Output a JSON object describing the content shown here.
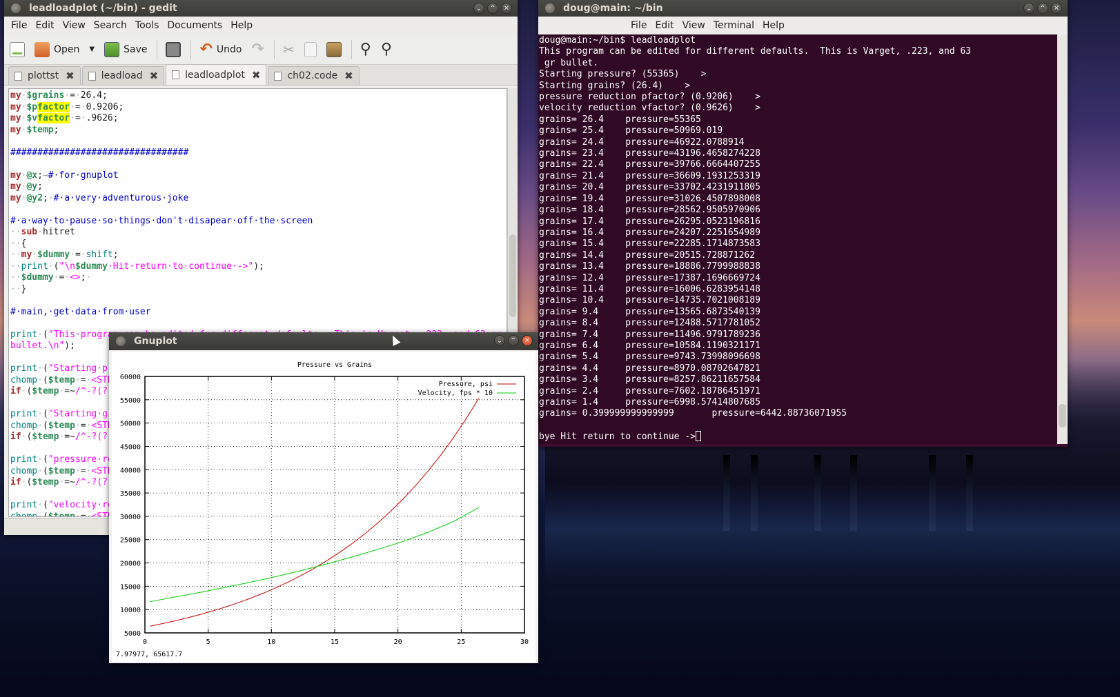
{
  "gedit": {
    "title": "leadloadplot (~/bin) - gedit",
    "menu": [
      "File",
      "Edit",
      "View",
      "Search",
      "Tools",
      "Documents",
      "Help"
    ],
    "toolbar": {
      "open_label": "Open",
      "save_label": "Save",
      "undo_label": "Undo"
    },
    "tabs": [
      {
        "label": "plottst",
        "active": false
      },
      {
        "label": "leadload",
        "active": false
      },
      {
        "label": "leadloadplot",
        "active": true
      },
      {
        "label": "ch02.code",
        "active": false
      }
    ]
  },
  "terminal": {
    "title": "doug@main: ~/bin",
    "menu": [
      "File",
      "Edit",
      "View",
      "Terminal",
      "Help"
    ],
    "lines": [
      "doug@main:~/bin$ leadloadplot",
      "This program can be edited for different defaults.  This is Varget, .223, and 63",
      " gr bullet.",
      "Starting pressure? (55365)    >",
      "Starting grains? (26.4)    >",
      "pressure reduction pfactor? (0.9206)    >",
      "velocity reduction vfactor? (0.9626)    >",
      "grains= 26.4    pressure=55365",
      "grains= 25.4    pressure=50969.019",
      "grains= 24.4    pressure=46922.0788914",
      "grains= 23.4    pressure=43196.4658274228",
      "grains= 22.4    pressure=39766.6664407255",
      "grains= 21.4    pressure=36609.1931253319",
      "grains= 20.4    pressure=33702.4231911805",
      "grains= 19.4    pressure=31026.4507898008",
      "grains= 18.4    pressure=28562.9505970906",
      "grains= 17.4    pressure=26295.0523196816",
      "grains= 16.4    pressure=24207.2251654989",
      "grains= 15.4    pressure=22285.1714873583",
      "grains= 14.4    pressure=20515.728871262",
      "grains= 13.4    pressure=18886.7799988838",
      "grains= 12.4    pressure=17387.1696669724",
      "grains= 11.4    pressure=16006.6283954148",
      "grains= 10.4    pressure=14735.7021008189",
      "grains= 9.4     pressure=13565.6873540139",
      "grains= 8.4     pressure=12488.5717781052",
      "grains= 7.4     pressure=11496.9791789236",
      "grains= 6.4     pressure=10584.1190321171",
      "grains= 5.4     pressure=9743.73998096698",
      "grains= 4.4     pressure=8970.08702647821",
      "grains= 3.4     pressure=8257.86211657584",
      "grains= 2.4     pressure=7602.18786451971",
      "grains= 1.4     pressure=6998.57414807685",
      "grains= 0.399999999999999       pressure=6442.88736071955",
      "",
      "bye Hit return to continue ->"
    ]
  },
  "gnuplot": {
    "title": "Gnuplot",
    "coords": "7.97977,  65617.7"
  },
  "chart_data": {
    "type": "line",
    "title": "Pressure vs Grains",
    "xlabel": "",
    "ylabel": "",
    "xlim": [
      0,
      30
    ],
    "ylim": [
      5000,
      60000
    ],
    "xticks": [
      0,
      5,
      10,
      15,
      20,
      25,
      30
    ],
    "yticks": [
      5000,
      10000,
      15000,
      20000,
      25000,
      30000,
      35000,
      40000,
      45000,
      50000,
      55000,
      60000
    ],
    "grid": true,
    "legend": "top-right",
    "series": [
      {
        "name": "Pressure, psi",
        "color": "#cc0000",
        "x": [
          0.4,
          1.4,
          2.4,
          3.4,
          4.4,
          5.4,
          6.4,
          7.4,
          8.4,
          9.4,
          10.4,
          11.4,
          12.4,
          13.4,
          14.4,
          15.4,
          16.4,
          17.4,
          18.4,
          19.4,
          20.4,
          21.4,
          22.4,
          23.4,
          24.4,
          25.4,
          26.4
        ],
        "y": [
          6442.89,
          6998.57,
          7602.19,
          8257.86,
          8970.09,
          9743.74,
          10584.12,
          11496.98,
          12488.57,
          13565.69,
          14735.7,
          16006.63,
          17387.17,
          18886.78,
          20515.73,
          22285.17,
          24207.23,
          26295.05,
          28562.95,
          31026.45,
          33702.42,
          36609.19,
          39766.67,
          43196.47,
          46922.08,
          50969.02,
          55365
        ]
      },
      {
        "name": "Velocity, fps * 10",
        "color": "#00cc00",
        "x": [
          0.4,
          2.4,
          4.4,
          6.4,
          8.4,
          10.4,
          12.4,
          14.4,
          16.4,
          18.4,
          20.4,
          22.4,
          24.4,
          26.4
        ],
        "y": [
          11700,
          12700,
          13700,
          14800,
          15900,
          17100,
          18400,
          19800,
          21300,
          22900,
          24600,
          26600,
          28900,
          31900
        ]
      }
    ]
  }
}
